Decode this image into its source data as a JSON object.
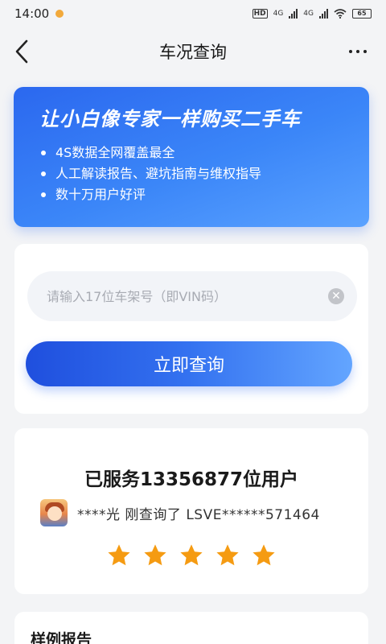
{
  "status_bar": {
    "time": "14:00",
    "network_1": "4G",
    "network_2": "4G",
    "hd_label": "HD",
    "battery": "65",
    "icons": [
      "sun-icon",
      "hd-icon",
      "signal-icon",
      "wifi-icon",
      "battery-icon"
    ]
  },
  "nav": {
    "title": "车况查询",
    "back_icon": "chevron-left-icon",
    "more_icon": "more-dots-icon"
  },
  "banner": {
    "title": "让小白像专家一样购买二手车",
    "points": [
      "4S数据全网覆盖最全",
      "人工解读报告、避坑指南与维权指导",
      "数十万用户好评"
    ]
  },
  "query": {
    "vin_placeholder": "请输入17位车架号（即VIN码）",
    "vin_value": "",
    "clear_icon": "clear-icon",
    "submit_label": "立即查询"
  },
  "served": {
    "title": "已服务13356877位用户",
    "recent_user": "****光",
    "recent_action": "刚查询了",
    "recent_vin": "LSVE******571464",
    "rating": 5,
    "rating_max": 5
  },
  "sample": {
    "title": "样例报告"
  },
  "colors": {
    "primary": "#2b68ef",
    "star": "#f59b12",
    "background": "#f3f4f6"
  }
}
